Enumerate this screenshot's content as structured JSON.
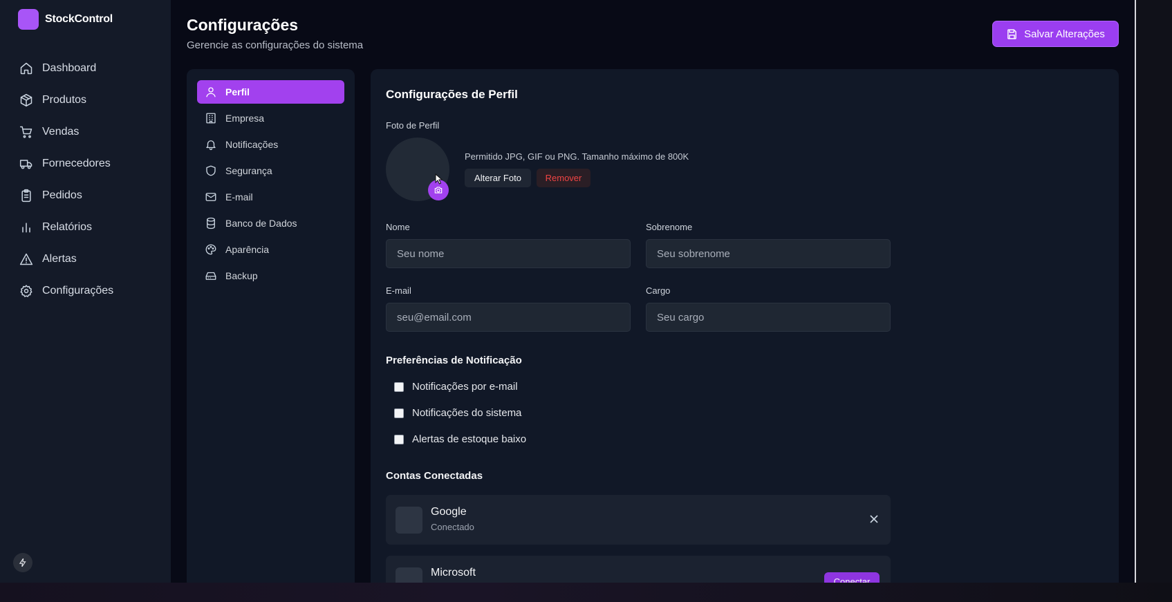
{
  "app": {
    "name": "StockControl"
  },
  "sidebar": {
    "items": [
      {
        "label": "Dashboard",
        "icon": "home-icon"
      },
      {
        "label": "Produtos",
        "icon": "package-icon"
      },
      {
        "label": "Vendas",
        "icon": "cart-icon"
      },
      {
        "label": "Fornecedores",
        "icon": "truck-icon"
      },
      {
        "label": "Pedidos",
        "icon": "clipboard-icon"
      },
      {
        "label": "Relatórios",
        "icon": "bar-chart-icon"
      },
      {
        "label": "Alertas",
        "icon": "warning-icon"
      },
      {
        "label": "Configurações",
        "icon": "gear-icon"
      }
    ]
  },
  "header": {
    "title": "Configurações",
    "subtitle": "Gerencie as configurações do sistema",
    "save_label": "Salvar Alterações"
  },
  "settings_nav": {
    "items": [
      {
        "label": "Perfil",
        "icon": "user-icon",
        "active": true
      },
      {
        "label": "Empresa",
        "icon": "building-icon"
      },
      {
        "label": "Notificações",
        "icon": "bell-icon"
      },
      {
        "label": "Segurança",
        "icon": "shield-icon"
      },
      {
        "label": "E-mail",
        "icon": "mail-icon"
      },
      {
        "label": "Banco de Dados",
        "icon": "database-icon"
      },
      {
        "label": "Aparência",
        "icon": "palette-icon"
      },
      {
        "label": "Backup",
        "icon": "hard-drive-icon"
      }
    ]
  },
  "profile": {
    "section_title": "Configurações de Perfil",
    "photo_label": "Foto de Perfil",
    "photo_hint": "Permitido JPG, GIF ou PNG. Tamanho máximo de 800K",
    "change_photo_label": "Alterar Foto",
    "remove_label": "Remover",
    "first_name": {
      "label": "Nome",
      "placeholder": "Seu nome",
      "value": ""
    },
    "last_name": {
      "label": "Sobrenome",
      "placeholder": "Seu sobrenome",
      "value": ""
    },
    "email": {
      "label": "E-mail",
      "placeholder": "seu@email.com",
      "value": ""
    },
    "role": {
      "label": "Cargo",
      "placeholder": "Seu cargo",
      "value": ""
    }
  },
  "notifications": {
    "title": "Preferências de Notificação",
    "options": [
      {
        "label": "Notificações por e-mail",
        "checked": false
      },
      {
        "label": "Notificações do sistema",
        "checked": false
      },
      {
        "label": "Alertas de estoque baixo",
        "checked": false
      }
    ]
  },
  "accounts": {
    "title": "Contas Conectadas",
    "items": [
      {
        "name": "Google",
        "status": "Conectado"
      },
      {
        "name": "Microsoft",
        "action": "Conectar"
      }
    ]
  },
  "colors": {
    "accent": "#a241ee",
    "danger": "#ef4444",
    "background": "#080a16",
    "panel": "#111827"
  }
}
